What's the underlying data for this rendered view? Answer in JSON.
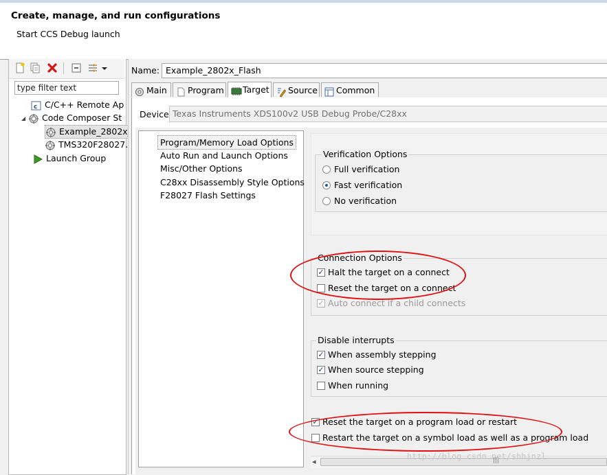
{
  "header": {
    "title": "Create, manage, and run configurations",
    "subtitle": "Start CCS Debug launch"
  },
  "left_panel": {
    "toolbar_icons": [
      "new-config-icon",
      "duplicate-icon",
      "delete-icon",
      "collapse-all-icon",
      "filter-icon",
      "dropdown-icon"
    ],
    "filter_placeholder": "type filter text",
    "tree": [
      {
        "label": "C/C++ Remote Ap",
        "icon": "c-app-icon",
        "level": 1
      },
      {
        "label": "Code Composer St",
        "icon": "ccs-icon",
        "level": 0,
        "expanded": true
      },
      {
        "label": "Example_2802x_",
        "icon": "ccs-config-icon",
        "level": 1,
        "selected": true
      },
      {
        "label": "TMS320F28027.",
        "icon": "ccs-config-icon",
        "level": 1
      },
      {
        "label": "Launch Group",
        "icon": "launch-group-icon",
        "level": 1
      }
    ]
  },
  "config": {
    "name_label": "Name:",
    "name_value": "Example_2802x_Flash",
    "tabs": [
      {
        "label": "Main",
        "icon": "main-tab-icon",
        "active": false
      },
      {
        "label": "Program",
        "icon": "program-tab-icon",
        "active": false
      },
      {
        "label": "Target",
        "icon": "target-tab-icon",
        "active": true
      },
      {
        "label": "Source",
        "icon": "source-tab-icon",
        "active": false
      },
      {
        "label": "Common",
        "icon": "common-tab-icon",
        "active": false
      }
    ],
    "device_label": "Device",
    "device_value": "Texas Instruments XDS100v2 USB Debug Probe/C28xx",
    "categories": [
      "Program/Memory Load Options",
      "Auto Run and Launch Options",
      "Misc/Other Options",
      "C28xx Disassembly Style Options",
      "F28027 Flash Settings"
    ],
    "selected_category": "Program/Memory Load Options"
  },
  "verification": {
    "title": "Verification Options",
    "options": [
      {
        "label": "Full verification",
        "selected": false
      },
      {
        "label": "Fast verification",
        "selected": true
      },
      {
        "label": "No verification",
        "selected": false
      }
    ]
  },
  "connection": {
    "title": "Connection Options",
    "options": [
      {
        "label": "Halt the target on a connect",
        "checked": true,
        "enabled": true
      },
      {
        "label": "Reset the target on a connect",
        "checked": false,
        "enabled": true
      },
      {
        "label": "Auto connect if a child connects",
        "checked": true,
        "enabled": false
      }
    ]
  },
  "interrupts": {
    "title": "Disable interrupts",
    "options": [
      {
        "label": "When assembly stepping",
        "checked": true
      },
      {
        "label": "When source stepping",
        "checked": true
      },
      {
        "label": "When running",
        "checked": false
      }
    ]
  },
  "load": {
    "options": [
      {
        "label": "Reset the target on a program load or restart",
        "checked": true
      },
      {
        "label": "Restart the target on a symbol load as well as a program load",
        "checked": false
      }
    ]
  },
  "scrollbar": {
    "left_arrow": "◂",
    "grip": "|||"
  },
  "annotation_color": "#e01010",
  "watermark": "http://blog.csdn.net/shhjnzl"
}
